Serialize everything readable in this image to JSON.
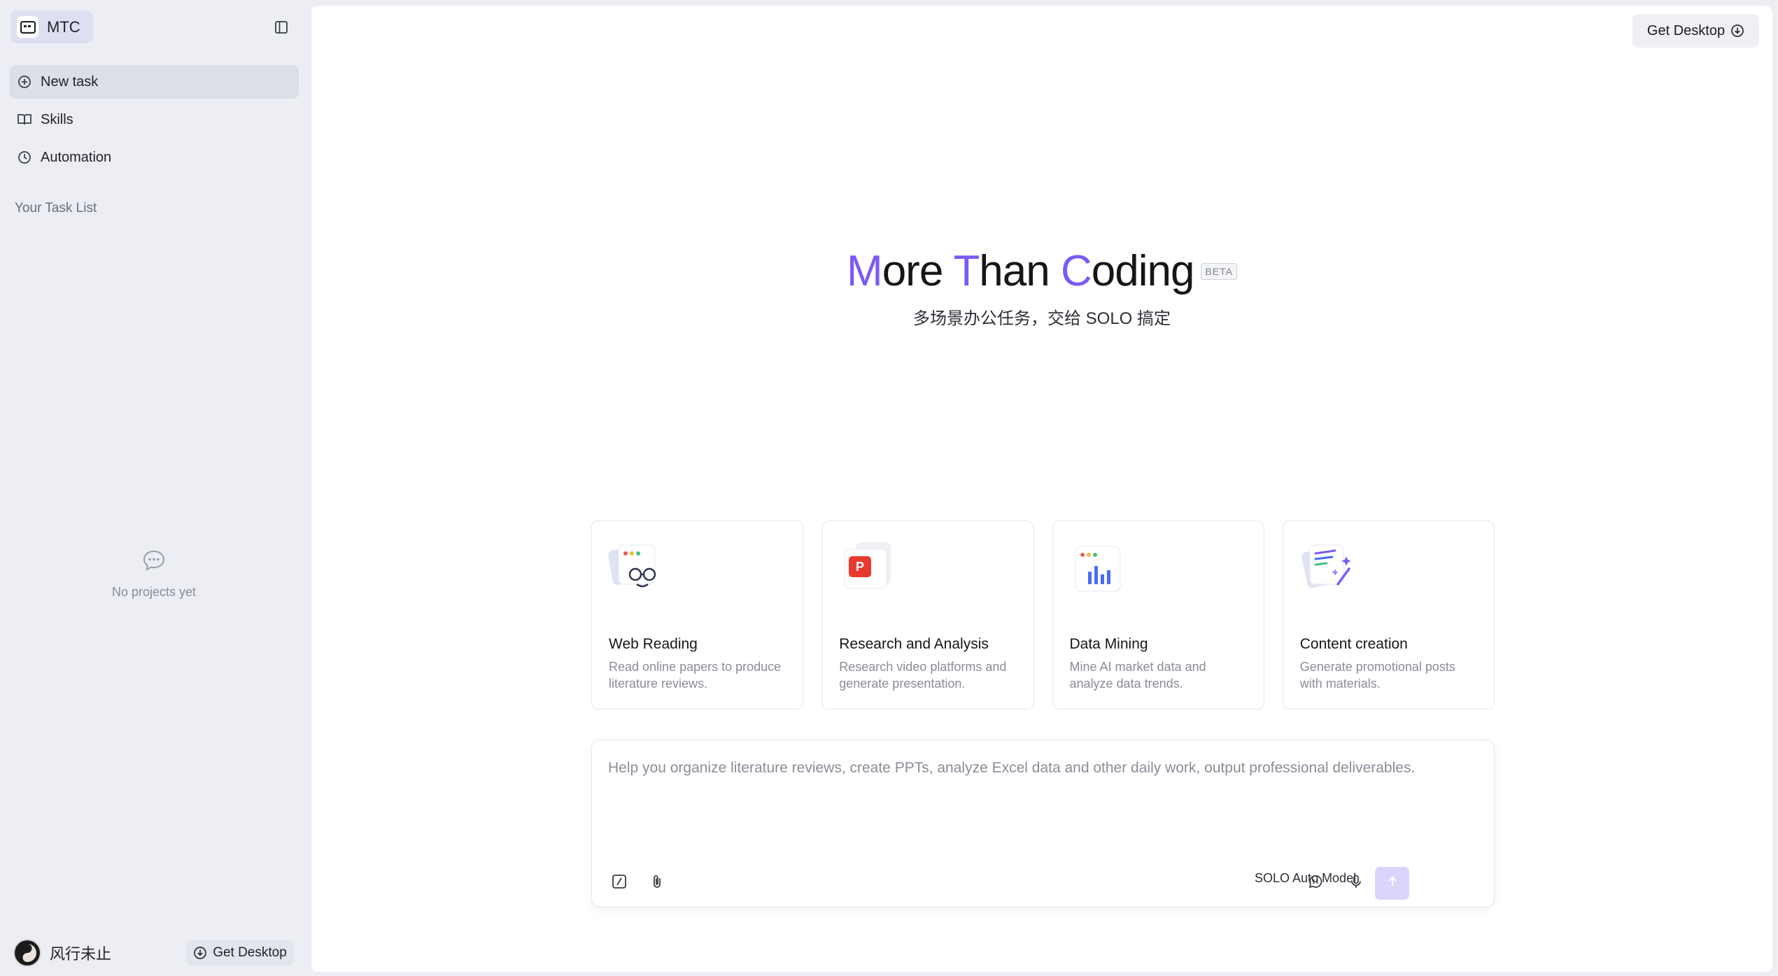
{
  "sidebar": {
    "brand": {
      "name": "MTC"
    },
    "nav": [
      {
        "label": "New task",
        "icon": "plus-circle-icon",
        "active": true
      },
      {
        "label": "Skills",
        "icon": "book-icon",
        "active": false
      },
      {
        "label": "Automation",
        "icon": "clock-icon",
        "active": false
      }
    ],
    "task_list_title": "Your Task List",
    "empty_projects": "No projects yet",
    "user": {
      "name": "风行未止"
    },
    "get_desktop_label": "Get Desktop"
  },
  "header": {
    "get_desktop_label": "Get Desktop"
  },
  "hero": {
    "title_parts": [
      "M",
      "ore ",
      "T",
      "han ",
      "C",
      "oding"
    ],
    "badge": "BETA",
    "subtitle": "多场景办公任务，交给 SOLO 搞定"
  },
  "cards": [
    {
      "title": "Web Reading",
      "desc": "Read online papers to produce literature reviews.",
      "icon": "web-reading-icon"
    },
    {
      "title": "Research and Analysis",
      "desc": "Research video platforms and generate presentation.",
      "icon": "presentation-icon"
    },
    {
      "title": "Data Mining",
      "desc": "Mine AI market data and analyze data trends.",
      "icon": "bar-chart-icon"
    },
    {
      "title": "Content creation",
      "desc": "Generate promotional posts with materials.",
      "icon": "content-creation-icon"
    }
  ],
  "composer": {
    "placeholder": "Help you organize literature reviews, create PPTs, analyze Excel data and other daily work, output professional deliverables.",
    "model": "SOLO Auto Model"
  },
  "colors": {
    "accent": "#7a5af8",
    "send_bg": "#dcd5fb",
    "sidebar_bg": "#eceef4"
  }
}
